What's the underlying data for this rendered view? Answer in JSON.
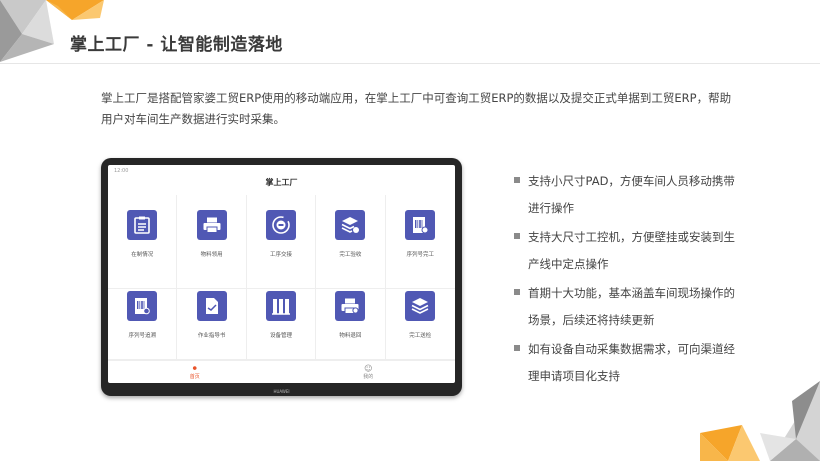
{
  "slide": {
    "title": "掌上工厂 - 让智能制造落地",
    "intro": "掌上工厂是搭配管家婆工贸ERP使用的移动端应用，在掌上工厂中可查询工贸ERP的数据以及提交正式单据到工贸ERP，帮助用户对车间生产数据进行实时采集。"
  },
  "tablet": {
    "status_left": "12:00",
    "app_title": "掌上工厂",
    "modules": [
      {
        "label": "在制情况",
        "icon": "clipboard-icon"
      },
      {
        "label": "物料领用",
        "icon": "printer-icon"
      },
      {
        "label": "工序交接",
        "icon": "cycle-icon"
      },
      {
        "label": "完工验收",
        "icon": "stack-check-icon"
      },
      {
        "label": "序列号完工",
        "icon": "barcode-check-icon"
      },
      {
        "label": "序列号追溯",
        "icon": "barcode-pin-icon"
      },
      {
        "label": "作业指导书",
        "icon": "document-icon"
      },
      {
        "label": "设备管理",
        "icon": "equipment-icon"
      },
      {
        "label": "物料退回",
        "icon": "return-printer-icon"
      },
      {
        "label": "完工送检",
        "icon": "stack-check-icon"
      }
    ],
    "nav": {
      "home": "首页",
      "mine": "我的"
    },
    "brand": "HUAWEI"
  },
  "features": [
    "支持小尺寸PAD，方便车间人员移动携带进行操作",
    "支持大尺寸工控机，方便壁挂或安装到生产线中定点操作",
    "首期十大功能，基本涵盖车间现场操作的场景，后续还将持续更新",
    "如有设备自动采集数据需求，可向渠道经理申请项目化支持"
  ],
  "colors": {
    "accent": "#5058b4",
    "orange": "#f29b25",
    "active": "#e9542b"
  }
}
